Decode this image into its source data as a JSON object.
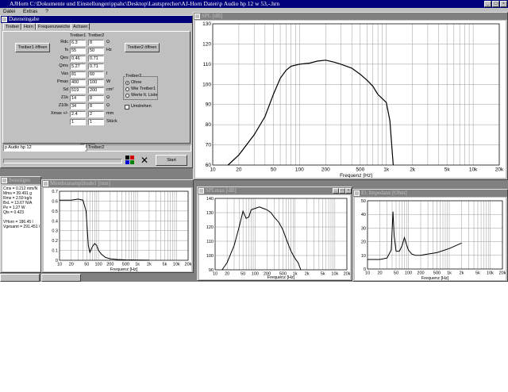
{
  "app": {
    "title": "AJHorn  C:\\Dokumente und Einstellungen\\ppahc\\Desktop\\Lautsprecher\\AJ-Horn Daten\\p Audio hp 12 w   53,-.hrn",
    "menu": [
      "Datei",
      "Extras",
      "?"
    ]
  },
  "dateneingabe": {
    "title": "Dateneingabe",
    "tabs": [
      "Treiber",
      "Horn",
      "Frequenzweiche",
      "Achsen"
    ],
    "col1": "Treiber1",
    "col2": "Treiber2",
    "btn_t1": "Treiber1 öffnen",
    "btn_t2": "Treiber2 öffnen",
    "params": [
      {
        "name": "Rdc",
        "v1": "6.3",
        "v2": "8",
        "unit": "Ω"
      },
      {
        "name": "fs",
        "v1": "55",
        "v2": "50",
        "unit": "Hz"
      },
      {
        "name": "Qes",
        "v1": "0.46",
        "v2": "0.71",
        "unit": ""
      },
      {
        "name": "Qms",
        "v1": "5.27",
        "v2": "0.71",
        "unit": ""
      },
      {
        "name": "Vas",
        "v1": "81",
        "v2": "60",
        "unit": "l"
      },
      {
        "name": "Pmax",
        "v1": "400",
        "v2": "100",
        "unit": "W"
      },
      {
        "name": "Sd",
        "v1": "519",
        "v2": "200",
        "unit": "cm²"
      },
      {
        "name": "Z1k",
        "v1": "14",
        "v2": "8",
        "unit": "Ω"
      },
      {
        "name": "Z10k",
        "v1": "34",
        "v2": "8",
        "unit": "Ω"
      },
      {
        "name": "Xmax +/-",
        "v1": "2.4",
        "v2": "2",
        "unit": "mm"
      },
      {
        "name": "",
        "v1": "1",
        "v2": "1",
        "unit": "Stück"
      }
    ],
    "ue_label": "Ue",
    "ue_value": "2.83",
    "ue_unit": "V",
    "group_title": "Treiber2",
    "radios": [
      "Ohne",
      "Wie Treiber1",
      "Werte lt. Liste"
    ],
    "checkbox": "Umdrehen",
    "field_left": "p Audio hp 12",
    "field_right": "Treiber2",
    "start": "Start"
  },
  "spl": {
    "title": "SPL [dB]",
    "xlabel": "Frequenz [Hz]",
    "yticks": [
      "130",
      "120",
      "110",
      "100",
      "90",
      "80",
      "70",
      "60"
    ],
    "xticks": [
      "10",
      "20",
      "50",
      "100",
      "200",
      "500",
      "1k",
      "2k",
      "5k",
      "10k",
      "20k"
    ]
  },
  "sonstiges": {
    "title": "Sonstiges",
    "lines": [
      "Cms = 0.212 mm/N",
      "Mms = 39.491 g",
      "Rms = 2.59 kg/s",
      "BxL = 13.67 N/A",
      "Pe = 1.27 W",
      "Qts = 0.423",
      "",
      "VHorn = 186.45 l",
      "Vgesamt = 291.451 l"
    ]
  },
  "membran": {
    "title": "Membranamplitude1 [mm]",
    "xlabel": "Frequenz [Hz]",
    "yticks": [
      "0.7",
      "0.6",
      "0.5",
      "0.4",
      "0.3",
      "0.2",
      "0.1",
      "0"
    ],
    "xticks": [
      "10",
      "20",
      "50",
      "100",
      "200",
      "500",
      "1k",
      "2k",
      "5k",
      "10k",
      "20k"
    ]
  },
  "splmax": {
    "title": "SPLmax [dB]",
    "xlabel": "Frequenz [Hz]",
    "yticks": [
      "140",
      "130",
      "120",
      "110",
      "100",
      "90"
    ],
    "xticks": [
      "10",
      "20",
      "50",
      "100",
      "200",
      "500",
      "1k",
      "2k",
      "5k",
      "10k",
      "20k"
    ]
  },
  "impedanz": {
    "title": "El. Impedanz [Ohm]",
    "xlabel": "Frequenz [Hz]",
    "yticks": [
      "50",
      "40",
      "30",
      "20",
      "10",
      "0"
    ],
    "xticks": [
      "10",
      "20",
      "50",
      "100",
      "200",
      "500",
      "1k",
      "2k",
      "5k",
      "10k",
      "20k"
    ]
  },
  "taskbar": [
    "",
    "",
    "",
    ""
  ],
  "chart_data": [
    {
      "type": "line",
      "title": "SPL [dB]",
      "xlabel": "Frequenz [Hz]",
      "xscale": "log",
      "xlim": [
        10,
        20000
      ],
      "ylim": [
        60,
        130
      ],
      "x": [
        15,
        20,
        30,
        40,
        50,
        60,
        70,
        80,
        100,
        130,
        160,
        200,
        250,
        300,
        400,
        500,
        600,
        700,
        800,
        1000,
        1100,
        1200
      ],
      "y": [
        60,
        65,
        75,
        84,
        95,
        103,
        107,
        109,
        110,
        110.5,
        111.5,
        112,
        111,
        110,
        108,
        105,
        102,
        99,
        95,
        91,
        82,
        60
      ]
    },
    {
      "type": "line",
      "title": "Membranamplitude1 [mm]",
      "xlabel": "Frequenz [Hz]",
      "xscale": "log",
      "xlim": [
        10,
        20000
      ],
      "ylim": [
        0,
        0.7
      ],
      "x": [
        10,
        20,
        30,
        40,
        48,
        55,
        60,
        70,
        80,
        90,
        100,
        120,
        150,
        200,
        300,
        500,
        1000,
        2000
      ],
      "y": [
        0.61,
        0.61,
        0.62,
        0.61,
        0.5,
        0.15,
        0.08,
        0.14,
        0.17,
        0.15,
        0.1,
        0.06,
        0.03,
        0.015,
        0.008,
        0.004,
        0.002,
        0.001
      ]
    },
    {
      "type": "line",
      "title": "SPLmax [dB]",
      "xlabel": "Frequenz [Hz]",
      "xscale": "log",
      "xlim": [
        10,
        20000
      ],
      "ylim": [
        90,
        140
      ],
      "x": [
        15,
        20,
        30,
        40,
        50,
        60,
        70,
        80,
        100,
        130,
        160,
        200,
        250,
        300,
        400,
        500,
        600,
        700,
        800,
        1000,
        1200,
        1400
      ],
      "y": [
        90,
        95,
        107,
        120,
        131,
        126,
        127,
        132,
        133,
        134,
        133,
        132,
        130,
        127,
        123,
        118,
        112,
        107,
        103,
        98,
        95,
        90
      ]
    },
    {
      "type": "line",
      "title": "El. Impedanz [Ohm]",
      "xlabel": "Frequenz [Hz]",
      "xscale": "log",
      "xlim": [
        10,
        20000
      ],
      "ylim": [
        0,
        50
      ],
      "x": [
        10,
        20,
        30,
        38,
        42,
        45,
        50,
        60,
        70,
        80,
        90,
        100,
        120,
        150,
        200,
        300,
        500,
        1000,
        2000
      ],
      "y": [
        7,
        7,
        8,
        14,
        42,
        24,
        13,
        13,
        17,
        23,
        18,
        14,
        11,
        10,
        10,
        11,
        12,
        15,
        19
      ]
    }
  ]
}
